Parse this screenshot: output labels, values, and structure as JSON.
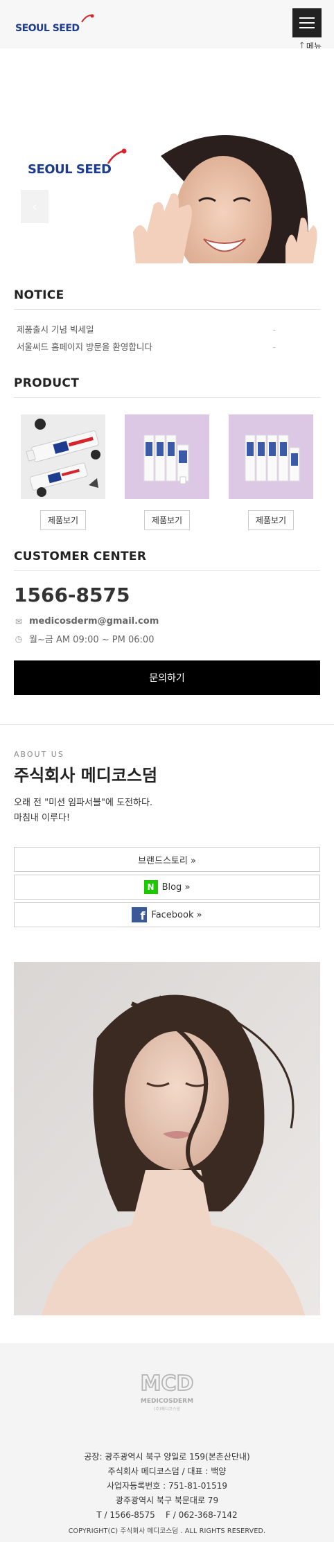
{
  "header": {
    "logo_text": "SEOUL SEED",
    "menu_label": "메뉴"
  },
  "hero": {
    "logo_text": "SEOUL SEED"
  },
  "notice": {
    "title": "NOTICE",
    "items": [
      {
        "title": "제품출시 기념 빅세일",
        "date": "-"
      },
      {
        "title": "서울씨드 홈페이지 방문을 환영합니다",
        "date": "-"
      }
    ]
  },
  "product": {
    "title": "PRODUCT",
    "items": [
      {
        "button": "제품보기"
      },
      {
        "button": "제품보기"
      },
      {
        "button": "제품보기"
      }
    ]
  },
  "customer": {
    "title": "CUSTOMER CENTER",
    "phone": "1566-8575",
    "email": "medicosderm@gmail.com",
    "hours": "월~금 AM 09:00 ~ PM 06:00",
    "inquiry_button": "문의하기"
  },
  "about": {
    "subtitle": "ABOUT US",
    "title": "주식회사 메디코스덤",
    "desc_line1": "오래 전 \"미션 임파서블\"에 도전하다.",
    "desc_line2": "마침내 이루다!",
    "buttons": {
      "brand_story": "브랜드스토리 »",
      "blog": "Blog »",
      "facebook": "Facebook »"
    }
  },
  "footer": {
    "logo_text": "MEDICOSDERM",
    "logo_sub": "(주)메디코스덤",
    "lines": [
      "공장: 광주광역시 북구 양일로 159(본촌산단내)",
      "주식회사 메디코스덤 / 대표 : 백양",
      "사업자등록번호 : 751-81-01519",
      "광주광역시 북구 북문대로 79",
      "T / 1566-8575    F / 062-368-7142"
    ],
    "copyright": "COPYRIGHT(C) 주식회사 메디코스덤 . ALL RIGHTS RESERVED."
  },
  "colors": {
    "brand_blue": "#1d3b8f",
    "brand_red": "#d8232a",
    "black": "#000000",
    "naver_green": "#1ec800",
    "facebook_blue": "#3b5998"
  }
}
